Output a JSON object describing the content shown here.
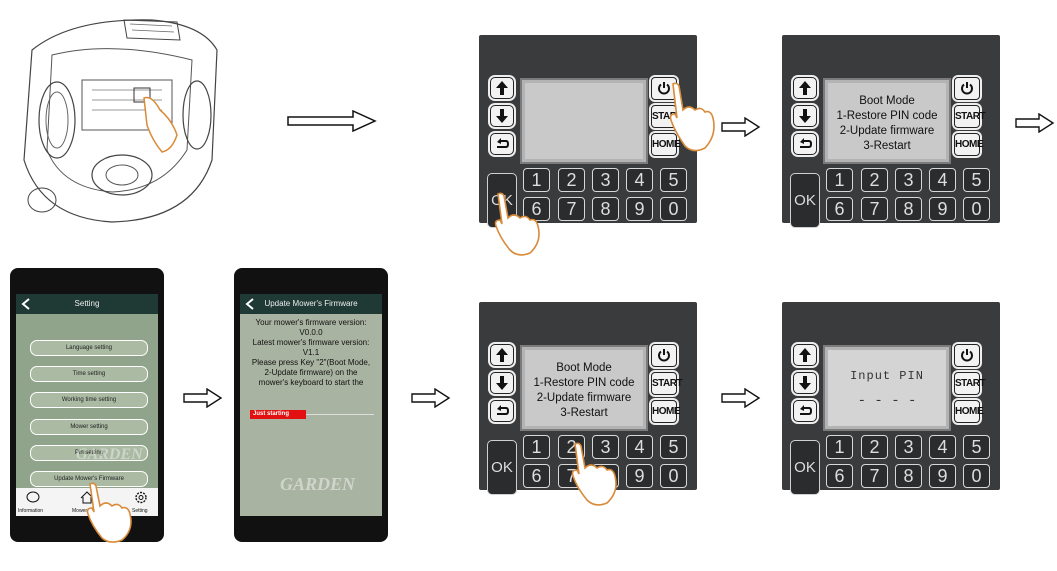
{
  "keypad": {
    "ok": "OK",
    "start": "START",
    "home": "HOME",
    "row1": [
      "1",
      "2",
      "3",
      "4",
      "5"
    ],
    "row2": [
      "6",
      "7",
      "8",
      "9",
      "0"
    ]
  },
  "boot_screen": {
    "line1": "Boot Mode",
    "line2": "1-Restore PIN code",
    "line3": "2-Update firmware",
    "line4": "3-Restart"
  },
  "pin_screen": {
    "title": "Input PIN",
    "dashes": "- - - -"
  },
  "setting_phone": {
    "title": "Setting",
    "items": [
      "Language setting",
      "Time setting",
      "Working time setting",
      "Mower setting",
      "Pin setting",
      "Update Mower's Firmware"
    ],
    "tabs": [
      "Information",
      "Mower status",
      "Setting"
    ],
    "watermark": "GARDEN"
  },
  "firmware_phone": {
    "title": "Update Mower's Firmware",
    "text1": "Your mower's firmware version:",
    "ver1": "V0.0.0",
    "text2": "Latest mower's firmware version:",
    "ver2": "V1.1",
    "text3": "Please press Key \"2\"(Boot Mode,",
    "text4": "2-Update firmware) on the",
    "text5": "mower's keyboard to start the",
    "status": "Just starting",
    "watermark": "GARDEN"
  },
  "colors": {
    "keypad_bg": "#3a3b3d",
    "screen": "#c9c9c9",
    "hand": "#d98b3a",
    "phone_header": "#1f3a34",
    "status_red": "#e21010"
  }
}
